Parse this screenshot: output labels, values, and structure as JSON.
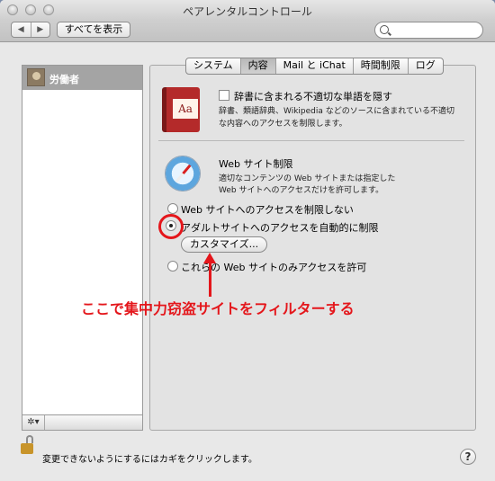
{
  "window": {
    "title": "ペアレンタルコントロール"
  },
  "toolbar": {
    "back_icon": "◀",
    "forward_icon": "▶",
    "show_all_label": "すべてを表示",
    "search_placeholder": ""
  },
  "users": [
    {
      "name": "労働者",
      "selected": true
    }
  ],
  "list_footer": {
    "gear_icon": "✲▾"
  },
  "tabs": [
    {
      "label": "システム",
      "active": false
    },
    {
      "label": "内容",
      "active": true
    },
    {
      "label": "Mail と iChat",
      "active": false
    },
    {
      "label": "時間制限",
      "active": false
    },
    {
      "label": "ログ",
      "active": false
    }
  ],
  "dictionary": {
    "book_text": "Aa",
    "checkbox_label": "辞書に含まれる不適切な単語を隠す",
    "description_line1": "辞書、類語辞典、Wikipedia などのソースに含まれている不適切",
    "description_line2": "な内容へのアクセスを制限します。"
  },
  "website": {
    "heading": "Web サイト制限",
    "description_line1": "適切なコンテンツの Web サイトまたは指定した",
    "description_line2": "Web サイトへのアクセスだけを許可します。",
    "options": [
      {
        "label": "Web サイトへのアクセスを制限しない",
        "selected": false
      },
      {
        "label": "アダルトサイトへのアクセスを自動的に制限",
        "selected": true
      },
      {
        "label": "これらの Web サイトのみアクセスを許可",
        "selected": false
      }
    ],
    "customize_label": "カスタマイズ..."
  },
  "annotation": {
    "text": "ここで集中力窃盗サイトをフィルターする",
    "color": "#e4161b"
  },
  "footer": {
    "lock_text": "変更できないようにするにはカギをクリックします。",
    "help_label": "?"
  }
}
